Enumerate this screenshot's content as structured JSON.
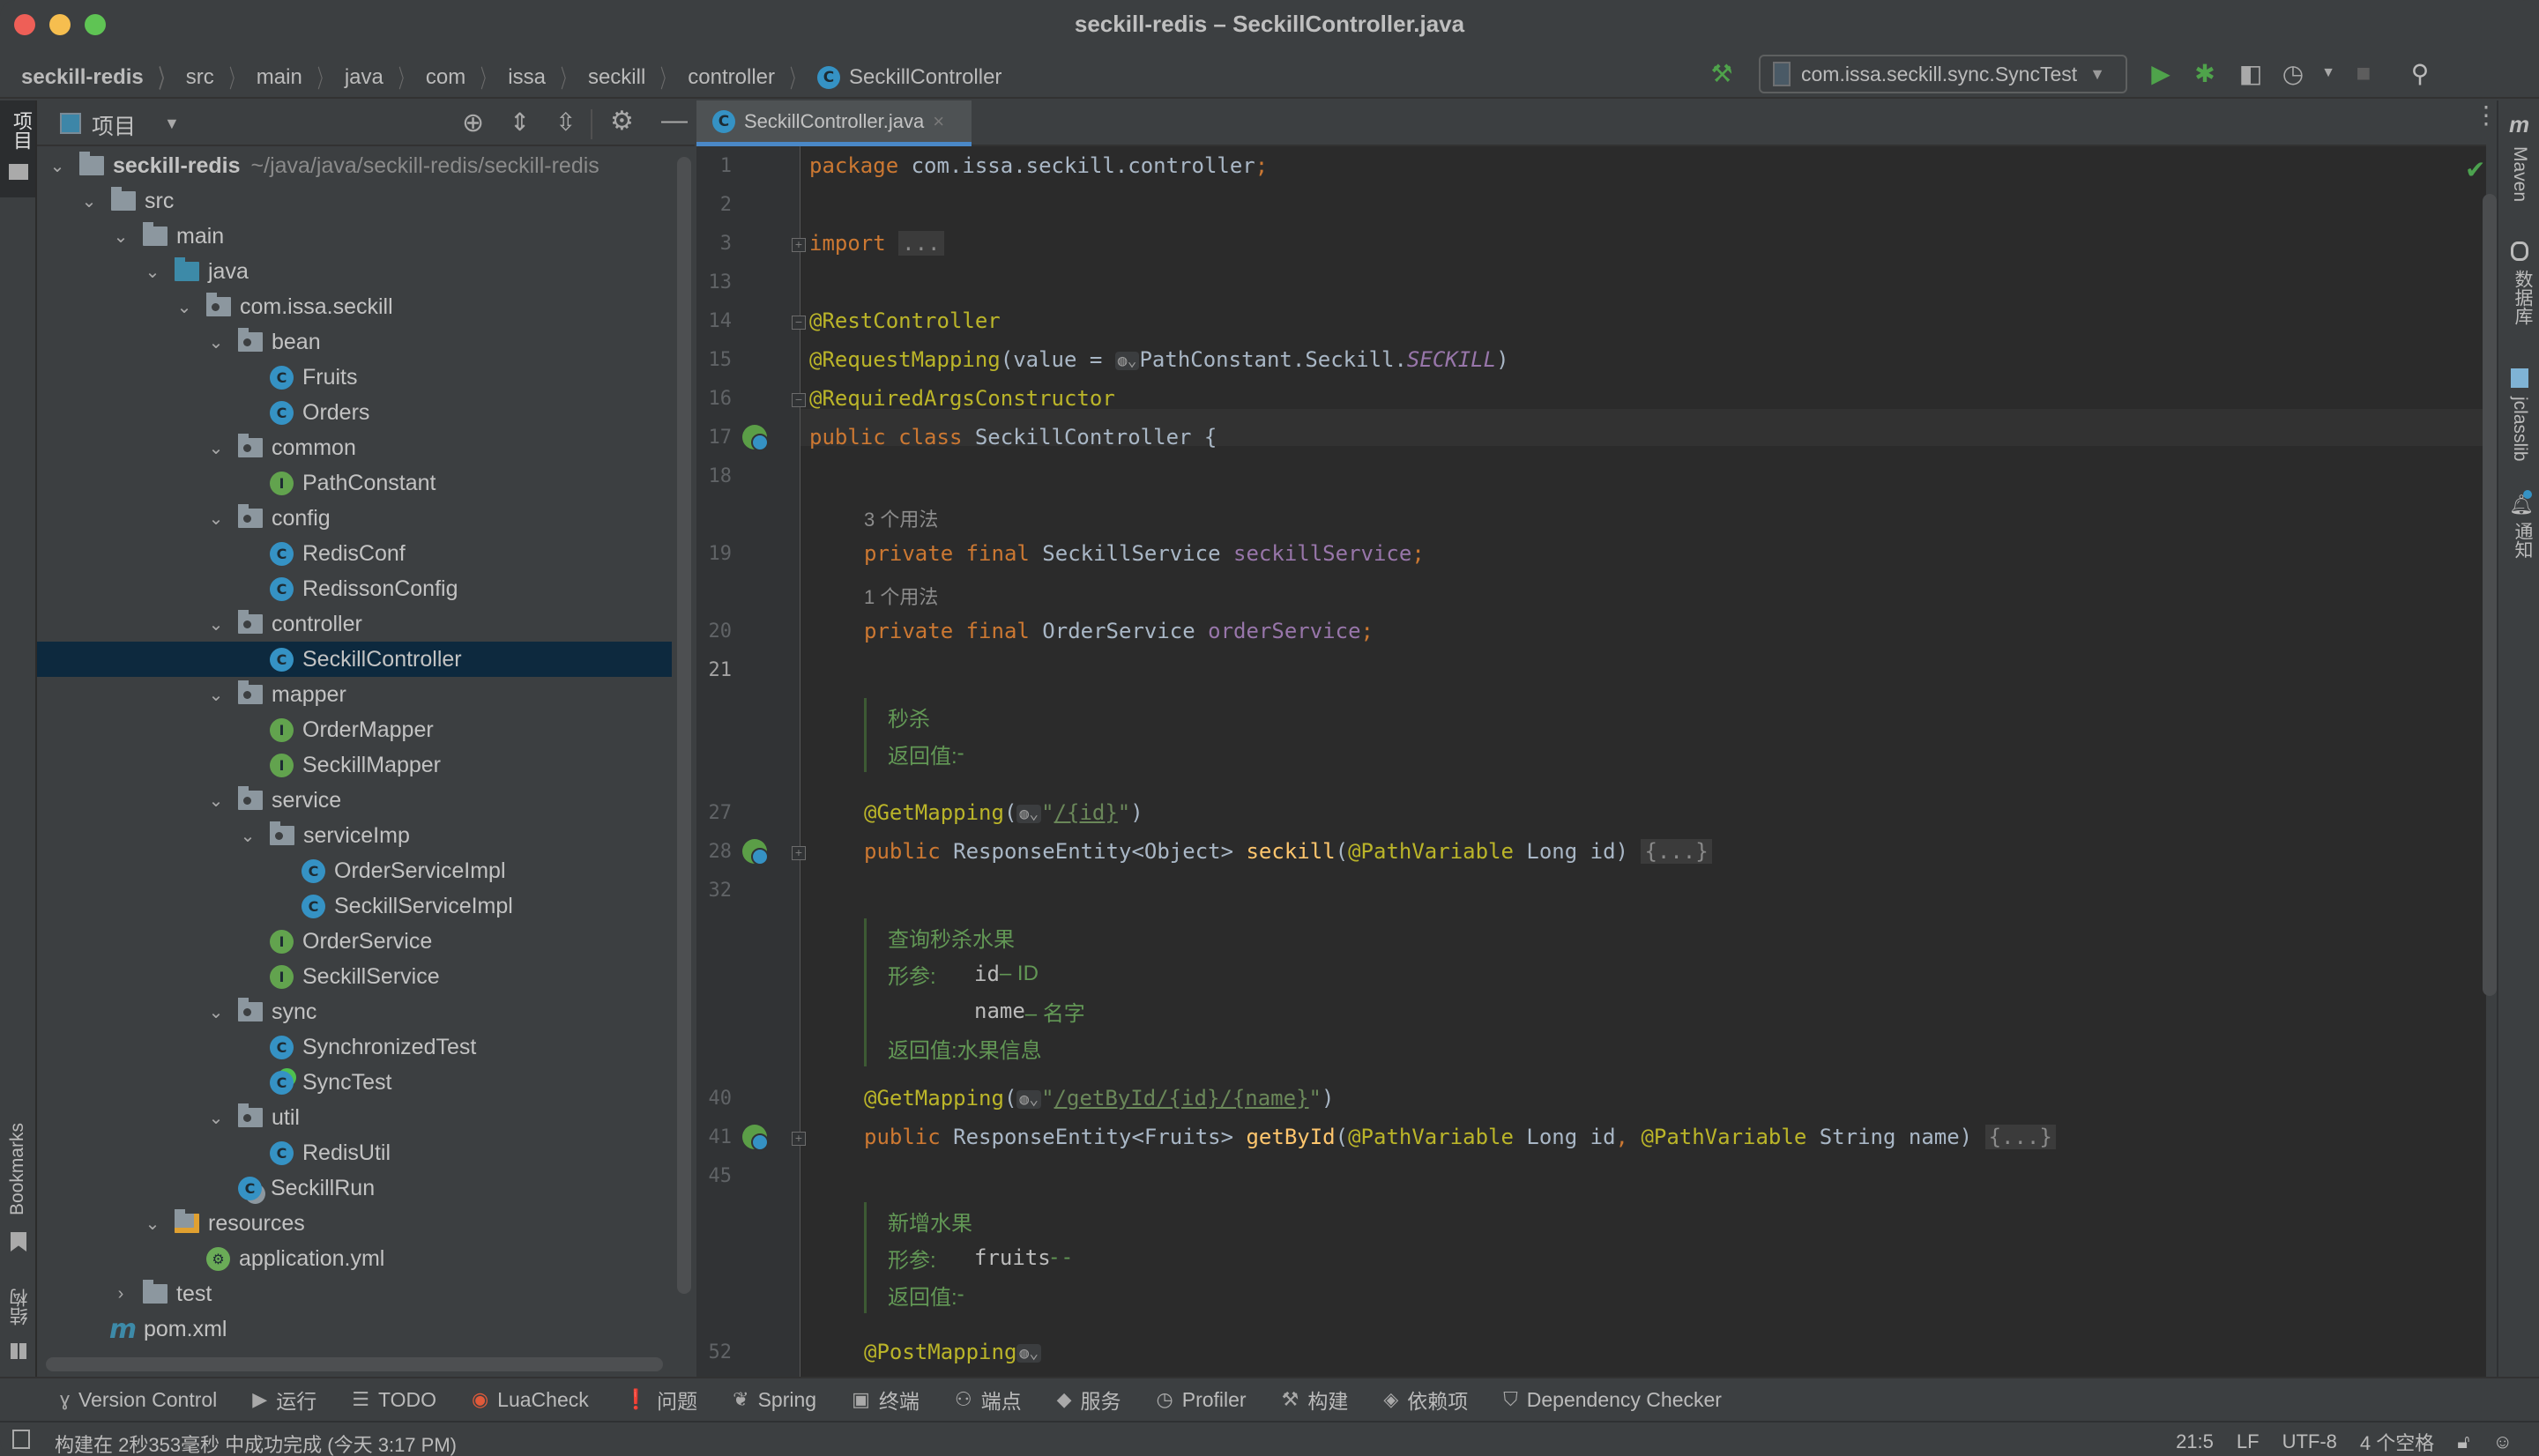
{
  "window": {
    "title": "seckill-redis – SeckillController.java",
    "traffic_lights": {
      "close": "#ee5f57",
      "minimize": "#f6be4f",
      "zoom": "#5fc454"
    }
  },
  "breadcrumb": [
    {
      "label": "seckill-redis"
    },
    {
      "label": "src"
    },
    {
      "label": "main"
    },
    {
      "label": "java"
    },
    {
      "label": "com"
    },
    {
      "label": "issa"
    },
    {
      "label": "seckill"
    },
    {
      "label": "controller"
    },
    {
      "label": "SeckillController",
      "icon": "class-icon"
    }
  ],
  "toolbar": {
    "build_icon": "hammer-icon",
    "run_config": "com.issa.seckill.sync.SyncTest",
    "run_icon": "run-icon",
    "debug_icon": "debug-icon",
    "coverage_icon": "coverage-icon",
    "profile_icon": "profile-icon",
    "stop_icon": "stop-icon",
    "search_icon": "search-icon",
    "update_icon": "update-icon",
    "plugin_icon": "toolbox-icon"
  },
  "left_strip": {
    "project_label": "项目",
    "bookmarks_label": "Bookmarks",
    "structure_label": "结构"
  },
  "project_panel": {
    "title": "项目",
    "root_path": "~/java/java/seckill-redis/seckill-redis",
    "tree": [
      {
        "label": "seckill-redis",
        "depth": 0,
        "type": "module",
        "expanded": true
      },
      {
        "label": "src",
        "depth": 1,
        "type": "folder",
        "expanded": true
      },
      {
        "label": "main",
        "depth": 2,
        "type": "folder",
        "expanded": true
      },
      {
        "label": "java",
        "depth": 3,
        "type": "source-folder",
        "expanded": true
      },
      {
        "label": "com.issa.seckill",
        "depth": 4,
        "type": "package",
        "expanded": true
      },
      {
        "label": "bean",
        "depth": 5,
        "type": "package",
        "expanded": true
      },
      {
        "label": "Fruits",
        "depth": 6,
        "type": "class"
      },
      {
        "label": "Orders",
        "depth": 6,
        "type": "class"
      },
      {
        "label": "common",
        "depth": 5,
        "type": "package",
        "expanded": true
      },
      {
        "label": "PathConstant",
        "depth": 6,
        "type": "interface"
      },
      {
        "label": "config",
        "depth": 5,
        "type": "package",
        "expanded": true
      },
      {
        "label": "RedisConf",
        "depth": 6,
        "type": "class"
      },
      {
        "label": "RedissonConfig",
        "depth": 6,
        "type": "class"
      },
      {
        "label": "controller",
        "depth": 5,
        "type": "package",
        "expanded": true
      },
      {
        "label": "SeckillController",
        "depth": 6,
        "type": "class",
        "selected": true
      },
      {
        "label": "mapper",
        "depth": 5,
        "type": "package",
        "expanded": true
      },
      {
        "label": "OrderMapper",
        "depth": 6,
        "type": "interface"
      },
      {
        "label": "SeckillMapper",
        "depth": 6,
        "type": "interface"
      },
      {
        "label": "service",
        "depth": 5,
        "type": "package",
        "expanded": true
      },
      {
        "label": "serviceImp",
        "depth": 6,
        "type": "package",
        "expanded": true
      },
      {
        "label": "OrderServiceImpl",
        "depth": 7,
        "type": "class"
      },
      {
        "label": "SeckillServiceImpl",
        "depth": 7,
        "type": "class"
      },
      {
        "label": "OrderService",
        "depth": 6,
        "type": "interface"
      },
      {
        "label": "SeckillService",
        "depth": 6,
        "type": "interface"
      },
      {
        "label": "sync",
        "depth": 5,
        "type": "package",
        "expanded": true
      },
      {
        "label": "SynchronizedTest",
        "depth": 6,
        "type": "class"
      },
      {
        "label": "SyncTest",
        "depth": 6,
        "type": "class-runnable"
      },
      {
        "label": "util",
        "depth": 5,
        "type": "package",
        "expanded": true
      },
      {
        "label": "RedisUtil",
        "depth": 6,
        "type": "class"
      },
      {
        "label": "SeckillRun",
        "depth": 5,
        "type": "spring-boot-class"
      },
      {
        "label": "resources",
        "depth": 3,
        "type": "resources-folder",
        "expanded": true
      },
      {
        "label": "application.yml",
        "depth": 4,
        "type": "spring-yml"
      },
      {
        "label": "test",
        "depth": 2,
        "type": "folder",
        "expanded": false
      },
      {
        "label": "pom.xml",
        "depth": 1,
        "type": "maven"
      }
    ]
  },
  "editor": {
    "tab": {
      "label": "SeckillController.java",
      "close": "×"
    },
    "current_line": "21",
    "lines": {
      "l1": {
        "no": "1",
        "kw": "package",
        "rest": " com.issa.seckill.controller",
        "semi": ";"
      },
      "l2": {
        "no": "2"
      },
      "l3": {
        "no": "3",
        "kw": "import",
        "fold": "..."
      },
      "l13": {
        "no": "13"
      },
      "l14": {
        "no": "14",
        "ann": "@RestController"
      },
      "l15": {
        "no": "15",
        "ann": "@RequestMapping",
        "pre": "(value = ",
        "ref": "PathConstant.Seckill.",
        "const": "SECKILL",
        "post": ")"
      },
      "l16": {
        "no": "16",
        "ann": "@RequiredArgsConstructor"
      },
      "l17": {
        "no": "17",
        "kw": "public class",
        "rest": " SeckillController {"
      },
      "l18": {
        "no": "18"
      },
      "hint19": "3 个用法",
      "l19": {
        "no": "19",
        "kw": "private final",
        "type": " SeckillService ",
        "field": "seckillService",
        "semi": ";"
      },
      "hint20": "1 个用法",
      "l20": {
        "no": "20",
        "kw": "private final",
        "type": " OrderService ",
        "field": "orderService",
        "semi": ";"
      },
      "l21": {
        "no": "21"
      },
      "doc1": {
        "summary": "秒杀",
        "return_label": "返回值:",
        "return_value": " -"
      },
      "l27": {
        "no": "27",
        "ann": "@GetMapping",
        "pre": "(",
        "q1": "\"",
        "url": "/{id}",
        "q2": "\"",
        "post": ")"
      },
      "l28": {
        "no": "28",
        "kw": "public",
        "type": " ResponseEntity<Object> ",
        "fn": "seckill",
        "p1": "(",
        "ann": "@PathVariable",
        "rest": " Long id) ",
        "fold": "{...}"
      },
      "l32": {
        "no": "32"
      },
      "doc2": {
        "summary": "查询秒杀水果",
        "param_label": "形参:",
        "params": [
          {
            "name": "id",
            "desc": " – ID"
          },
          {
            "name": "name",
            "desc": " – 名字"
          }
        ],
        "return_label": "返回值:",
        "return_value": " 水果信息"
      },
      "l40": {
        "no": "40",
        "ann": "@GetMapping",
        "pre": "(",
        "q1": "\"",
        "url": "/getById/{id}/{name}",
        "q2": "\"",
        "post": ")"
      },
      "l41": {
        "no": "41",
        "kw": "public",
        "type": " ResponseEntity<Fruits> ",
        "fn": "getById",
        "p1": "(",
        "ann1": "@PathVariable",
        "mid": " Long id",
        "comma": ", ",
        "ann2": "@PathVariable",
        "rest": " String name) ",
        "fold": "{...}"
      },
      "l45": {
        "no": "45"
      },
      "doc3": {
        "summary": "新增水果",
        "param_label": "形参:",
        "params": [
          {
            "name": "fruits",
            "desc": " - -"
          }
        ],
        "return_label": "返回值:",
        "return_value": " -"
      },
      "l52": {
        "no": "52",
        "ann": "@PostMapping"
      }
    },
    "inlay_icon": "web-endpoint-icon",
    "inspection_status": "ok"
  },
  "right_strip": [
    {
      "label": "Maven",
      "icon": "maven-icon"
    },
    {
      "label": "数据库",
      "icon": "database-icon"
    },
    {
      "label": "jclasslib",
      "icon": "jclasslib-icon"
    },
    {
      "label": "通知",
      "icon": "notification-icon"
    }
  ],
  "bottom_tools": [
    {
      "label": "Version Control",
      "icon": "vcs-icon",
      "glyph": "ɣ"
    },
    {
      "label": "运行",
      "icon": "run-icon",
      "glyph": "▶"
    },
    {
      "label": "TODO",
      "icon": "todo-icon",
      "glyph": "☰"
    },
    {
      "label": "LuaCheck",
      "icon": "luacheck-icon",
      "glyph": "◉"
    },
    {
      "label": "问题",
      "icon": "problems-icon",
      "glyph": "❗"
    },
    {
      "label": "Spring",
      "icon": "spring-icon",
      "glyph": "❦"
    },
    {
      "label": "终端",
      "icon": "terminal-icon",
      "glyph": "▣"
    },
    {
      "label": "端点",
      "icon": "endpoints-icon",
      "glyph": "⚇"
    },
    {
      "label": "服务",
      "icon": "services-icon",
      "glyph": "◆"
    },
    {
      "label": "Profiler",
      "icon": "profiler-icon",
      "glyph": "◷"
    },
    {
      "label": "构建",
      "icon": "build-icon",
      "glyph": "⚒"
    },
    {
      "label": "依赖项",
      "icon": "dependencies-icon",
      "glyph": "◈"
    },
    {
      "label": "Dependency Checker",
      "icon": "dependency-checker-icon",
      "glyph": "⛉"
    }
  ],
  "status_bar": {
    "message": "构建在 2秒353毫秒 中成功完成 (今天 3:17 PM)",
    "position": "21:5",
    "line_separator": "LF",
    "encoding": "UTF-8",
    "indent": "4 个空格",
    "lock_icon": "unlock-icon",
    "inspector_icon": "inspector-icon"
  }
}
